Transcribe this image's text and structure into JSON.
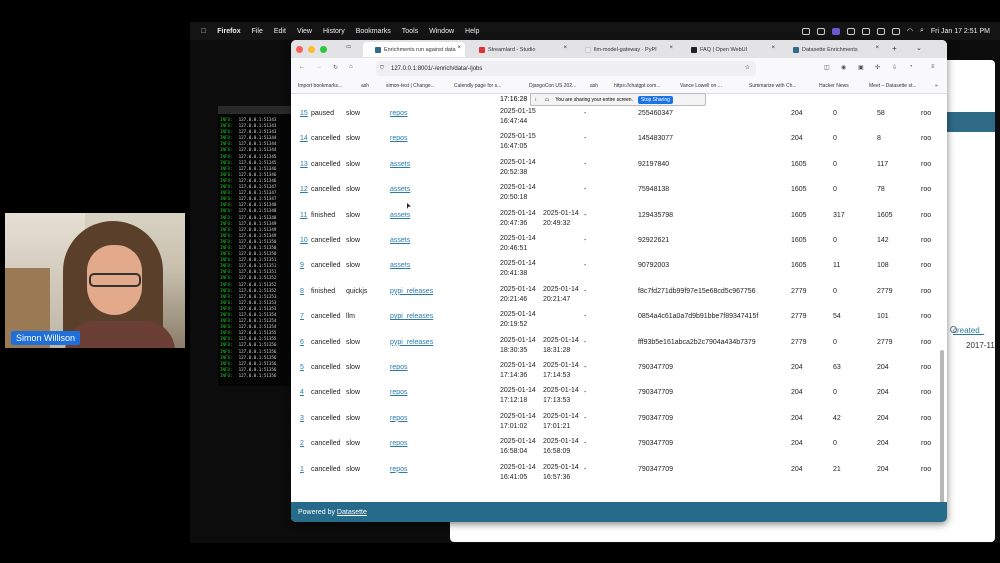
{
  "menubar": {
    "apple": "",
    "items": [
      "Firefox",
      "File",
      "Edit",
      "View",
      "History",
      "Bookmarks",
      "Tools",
      "Window",
      "Help"
    ],
    "clock": "Fri Jan 17  2:51 PM"
  },
  "terminal": {
    "level": "INFO:",
    "lines": [
      "127.0.0.1:51343",
      "127.0.0.1:51343",
      "127.0.0.1:51343",
      "127.0.0.1:51344",
      "127.0.0.1:51344",
      "127.0.0.1:51344",
      "127.0.0.1:51345",
      "127.0.0.1:51345",
      "127.0.0.1:51346",
      "127.0.0.1:51346",
      "127.0.0.1:51346",
      "127.0.0.1:51347",
      "127.0.0.1:51347",
      "127.0.0.1:51347",
      "127.0.0.1:51348",
      "127.0.0.1:51348",
      "127.0.0.1:51348",
      "127.0.0.1:51349",
      "127.0.0.1:51349",
      "127.0.0.1:51349",
      "127.0.0.1:51350",
      "127.0.0.1:51350",
      "127.0.0.1:51350",
      "127.0.0.1:51351",
      "127.0.0.1:51351",
      "127.0.0.1:51351",
      "127.0.0.1:51352",
      "127.0.0.1:51352",
      "127.0.0.1:51352",
      "127.0.0.1:51353",
      "127.0.0.1:51353",
      "127.0.0.1:51353",
      "127.0.0.1:51354",
      "127.0.0.1:51354",
      "127.0.0.1:51354",
      "127.0.0.1:51355",
      "127.0.0.1:51355",
      "127.0.0.1:51356",
      "127.0.0.1:51356",
      "127.0.0.1:51356",
      "127.0.0.1:51356",
      "127.0.0.1:51356",
      "127.0.0.1:51356"
    ]
  },
  "webcam": {
    "name": "Simon Willison"
  },
  "bg_window": {
    "column": "created_",
    "value": "2017-11"
  },
  "browser": {
    "tabs": [
      {
        "label": "Enrichments run against data",
        "color": "#2f6b87"
      },
      {
        "label": "Streamlard - Studio",
        "color": "#d33"
      },
      {
        "label": "llm-model-gateway · PyPI",
        "color": "#e9e9e9"
      },
      {
        "label": "FAQ | Open WebUI",
        "color": "#222"
      },
      {
        "label": "Datasette Enrichments",
        "color": "#2f6b87"
      }
    ],
    "url": "127.0.0.1:8001/-/enrich/data/-/jobs",
    "bookmarks": [
      "Import bookmarks...",
      "ash",
      "simon-test | Change...",
      "Calendly page for s...",
      "DjangoCon US 202...",
      "ash",
      "https://chatgpt.com...",
      "Vance Lowell on ...",
      "Summarize with Ch...",
      "Hacker News",
      "Meet – Datasette st..."
    ],
    "share_text": "You are sharing your entire screen.",
    "share_button": "Stop Sharing",
    "partial_time": "17:16:28",
    "footer_prefix": "Powered by ",
    "footer_link": "Datasette"
  },
  "jobs": [
    {
      "id": "15",
      "status": "paused",
      "model": "slow",
      "table": "repos",
      "started_date": "2025-01-15",
      "started_time": "16:47:44",
      "finished_date": "",
      "finished_time": "",
      "dash": "-",
      "hash": "255460347",
      "a": "204",
      "b": "0",
      "c": "58",
      "d": "roo"
    },
    {
      "id": "14",
      "status": "cancelled",
      "model": "slow",
      "table": "repos",
      "started_date": "2025-01-15",
      "started_time": "16:47:05",
      "finished_date": "",
      "finished_time": "",
      "dash": "-",
      "hash": "145483077",
      "a": "204",
      "b": "0",
      "c": "8",
      "d": "roo"
    },
    {
      "id": "13",
      "status": "cancelled",
      "model": "slow",
      "table": "assets",
      "started_date": "2025-01-14",
      "started_time": "20:52:38",
      "finished_date": "",
      "finished_time": "",
      "dash": "-",
      "hash": "92197840",
      "a": "1605",
      "b": "0",
      "c": "117",
      "d": "roo"
    },
    {
      "id": "12",
      "status": "cancelled",
      "model": "slow",
      "table": "assets",
      "started_date": "2025-01-14",
      "started_time": "20:50:18",
      "finished_date": "",
      "finished_time": "",
      "dash": "-",
      "hash": "75948138",
      "a": "1605",
      "b": "0",
      "c": "78",
      "d": "roo"
    },
    {
      "id": "11",
      "status": "finished",
      "model": "slow",
      "table": "assets",
      "started_date": "2025-01-14",
      "started_time": "20:47:36",
      "finished_date": "2025-01-14",
      "finished_time": "20:49:32",
      "dash": "-",
      "hash": "129435798",
      "a": "1605",
      "b": "317",
      "c": "1605",
      "d": "roo"
    },
    {
      "id": "10",
      "status": "cancelled",
      "model": "slow",
      "table": "assets",
      "started_date": "2025-01-14",
      "started_time": "20:46:51",
      "finished_date": "",
      "finished_time": "",
      "dash": "-",
      "hash": "92922621",
      "a": "1605",
      "b": "0",
      "c": "142",
      "d": "roo"
    },
    {
      "id": "9",
      "status": "cancelled",
      "model": "slow",
      "table": "assets",
      "started_date": "2025-01-14",
      "started_time": "20:41:38",
      "finished_date": "",
      "finished_time": "",
      "dash": "-",
      "hash": "90792003",
      "a": "1605",
      "b": "11",
      "c": "108",
      "d": "roo"
    },
    {
      "id": "8",
      "status": "finished",
      "model": "quickjs",
      "table": "pypi_releases",
      "started_date": "2025-01-14",
      "started_time": "20:21:46",
      "finished_date": "2025-01-14",
      "finished_time": "20:21:47",
      "dash": "-",
      "hash": "f8c7fd271db99f97e15e68cd5c967756",
      "a": "2779",
      "b": "0",
      "c": "2779",
      "d": "roo"
    },
    {
      "id": "7",
      "status": "cancelled",
      "model": "llm",
      "table": "pypi_releases",
      "started_date": "2025-01-14",
      "started_time": "20:19:52",
      "finished_date": "",
      "finished_time": "",
      "dash": "-",
      "hash": "0854a4c61a0a7d9b91bbe7f89347415f",
      "a": "2779",
      "b": "54",
      "c": "101",
      "d": "roo"
    },
    {
      "id": "6",
      "status": "cancelled",
      "model": "slow",
      "table": "pypi_releases",
      "started_date": "2025-01-14",
      "started_time": "18:30:35",
      "finished_date": "2025-01-14",
      "finished_time": "18:31:28",
      "dash": "-",
      "hash": "fff93b5e161abca2b2c7904a434b7379",
      "a": "2779",
      "b": "0",
      "c": "2779",
      "d": "roo"
    },
    {
      "id": "5",
      "status": "cancelled",
      "model": "slow",
      "table": "repos",
      "started_date": "2025-01-14",
      "started_time": "17:14:36",
      "finished_date": "2025-01-14",
      "finished_time": "17:14:53",
      "dash": "-",
      "hash": "790347709",
      "a": "204",
      "b": "63",
      "c": "204",
      "d": "roo"
    },
    {
      "id": "4",
      "status": "cancelled",
      "model": "slow",
      "table": "repos",
      "started_date": "2025-01-14",
      "started_time": "17:12:18",
      "finished_date": "2025-01-14",
      "finished_time": "17:13:53",
      "dash": "-",
      "hash": "790347709",
      "a": "204",
      "b": "0",
      "c": "204",
      "d": "roo"
    },
    {
      "id": "3",
      "status": "cancelled",
      "model": "slow",
      "table": "repos",
      "started_date": "2025-01-14",
      "started_time": "17:01:02",
      "finished_date": "2025-01-14",
      "finished_time": "17:01:21",
      "dash": "-",
      "hash": "790347709",
      "a": "204",
      "b": "42",
      "c": "204",
      "d": "roo"
    },
    {
      "id": "2",
      "status": "cancelled",
      "model": "slow",
      "table": "repos",
      "started_date": "2025-01-14",
      "started_time": "16:58:04",
      "finished_date": "2025-01-14",
      "finished_time": "16:58:09",
      "dash": "-",
      "hash": "790347709",
      "a": "204",
      "b": "0",
      "c": "204",
      "d": "roo"
    },
    {
      "id": "1",
      "status": "cancelled",
      "model": "slow",
      "table": "repos",
      "started_date": "2025-01-14",
      "started_time": "16:41:05",
      "finished_date": "2025-01-14",
      "finished_time": "16:57:36",
      "dash": "-",
      "hash": "790347709",
      "a": "204",
      "b": "21",
      "c": "204",
      "d": "roo"
    }
  ]
}
